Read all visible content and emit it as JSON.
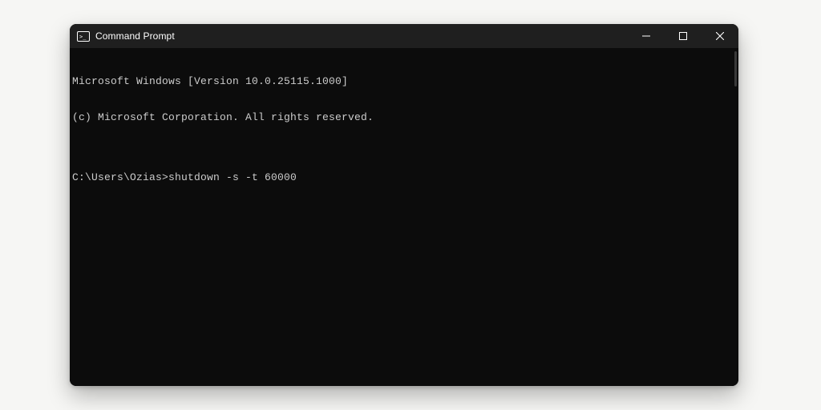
{
  "window": {
    "title": "Command Prompt",
    "icon": "cmd-icon"
  },
  "terminal": {
    "banner_line1": "Microsoft Windows [Version 10.0.25115.1000]",
    "banner_line2": "(c) Microsoft Corporation. All rights reserved.",
    "blank": "",
    "prompt": "C:\\Users\\Ozias>",
    "command": "shutdown -s -t 60000"
  },
  "controls": {
    "minimize": "minimize",
    "maximize": "maximize",
    "close": "close"
  }
}
